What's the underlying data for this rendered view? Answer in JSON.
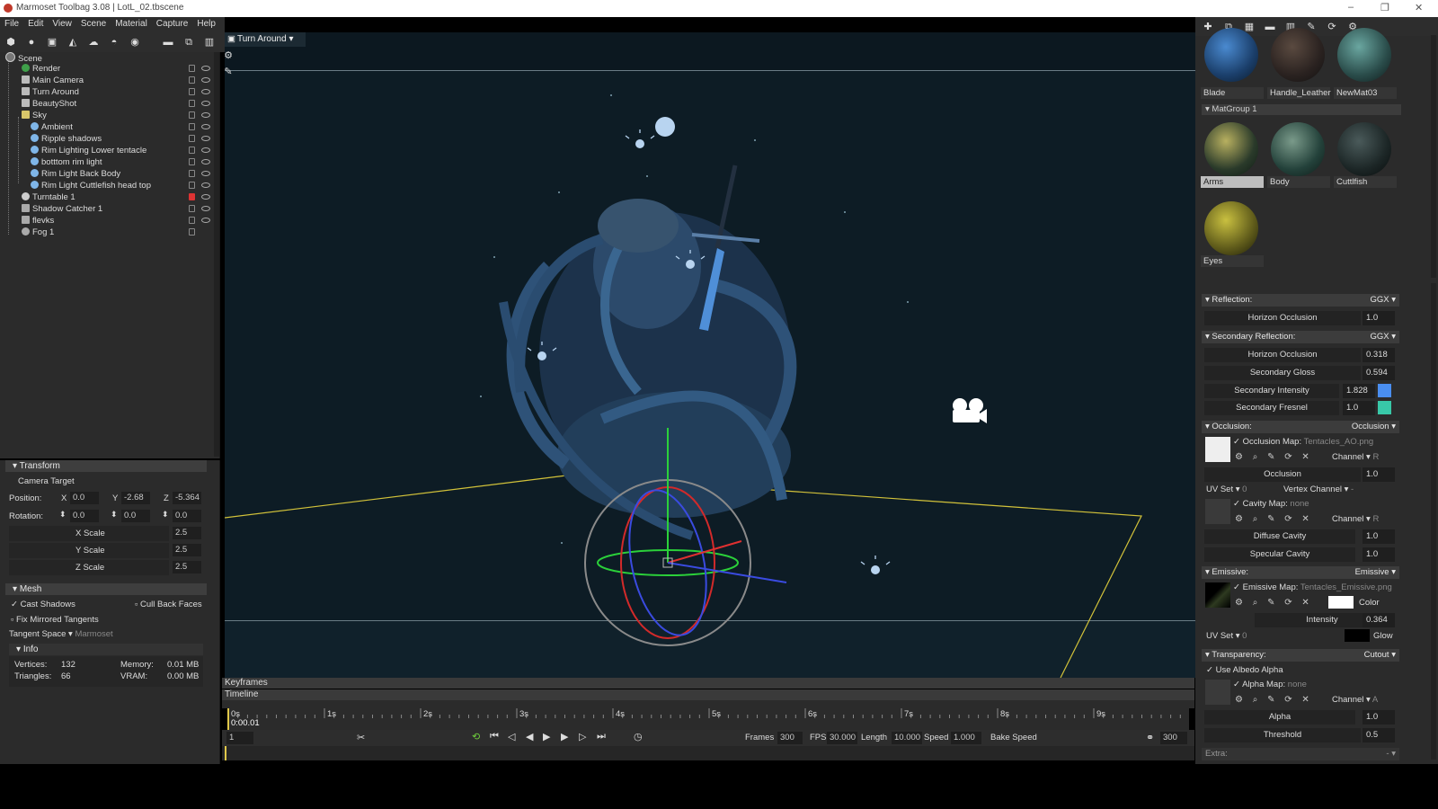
{
  "window": {
    "title": "Marmoset Toolbag 3.08  |  LotL_02.tbscene",
    "minimize": "–",
    "restore": "❐",
    "close": "✕"
  },
  "menu": [
    "File",
    "Edit",
    "View",
    "Scene",
    "Material",
    "Capture",
    "Help"
  ],
  "viewport": {
    "camera_label": "Turn Around ▾"
  },
  "outliner": {
    "items": [
      {
        "label": "Scene",
        "icon": "scene-icon",
        "depth": 0
      },
      {
        "label": "Render",
        "icon": "render-icon",
        "depth": 1
      },
      {
        "label": "Main Camera",
        "icon": "camera-icon",
        "depth": 1
      },
      {
        "label": "Turn Around",
        "icon": "camera-icon",
        "depth": 1
      },
      {
        "label": "BeautyShot",
        "icon": "camera-icon",
        "depth": 1
      },
      {
        "label": "Sky",
        "icon": "sky-icon",
        "depth": 1
      },
      {
        "label": "Ambient",
        "icon": "light-icon",
        "depth": 2
      },
      {
        "label": "Ripple shadows",
        "icon": "light-icon",
        "depth": 2
      },
      {
        "label": "Rim Lighting Lower tentacle",
        "icon": "light-icon",
        "depth": 2
      },
      {
        "label": "botttom rim light",
        "icon": "light-icon",
        "depth": 2
      },
      {
        "label": "Rim Light Back Body",
        "icon": "light-icon",
        "depth": 2
      },
      {
        "label": "Rim Light Cuttlefish head top",
        "icon": "light-icon",
        "depth": 2
      },
      {
        "label": "Turntable 1",
        "icon": "turntable-icon",
        "depth": 1
      },
      {
        "label": "Shadow Catcher 1",
        "icon": "shadow-icon",
        "depth": 1
      },
      {
        "label": "flevks",
        "icon": "mesh-icon",
        "depth": 1
      },
      {
        "label": "Fog 1",
        "icon": "fog-icon",
        "depth": 1
      }
    ]
  },
  "transform": {
    "header": "Transform",
    "camera_target": "Camera Target",
    "position_label": "Position:",
    "rotation_label": "Rotation:",
    "x": "X",
    "y": "Y",
    "z": "Z",
    "pos_x": "0.0",
    "pos_y": "-2.68",
    "pos_z": "-5.364",
    "rot_x": "0.0",
    "rot_y": "0.0",
    "rot_z": "0.0",
    "xscale_label": "X Scale",
    "yscale_label": "Y Scale",
    "zscale_label": "Z Scale",
    "xscale": "2.5",
    "yscale": "2.5",
    "zscale": "2.5"
  },
  "mesh": {
    "header": "Mesh",
    "cast_shadows": "Cast Shadows",
    "cull_back_faces": "Cull Back Faces",
    "fix_mirrored": "Fix Mirrored Tangents",
    "tangent_space_label": "Tangent Space ▾",
    "tangent_space_value": "Marmoset",
    "info_header": "Info",
    "vertices_label": "Vertices:",
    "vertices": "132",
    "triangles_label": "Triangles:",
    "triangles": "66",
    "memory_label": "Memory:",
    "memory": "0.01 MB",
    "vram_label": "VRAM:",
    "vram": "0.00 MB"
  },
  "timeline": {
    "keyframes": "Keyframes",
    "timeline": "Timeline",
    "current_time": "0:00.01",
    "ticks": [
      "0s",
      "1s",
      "2s",
      "3s",
      "4s",
      "5s",
      "6s",
      "7s",
      "8s",
      "9s"
    ],
    "frame_field": "1",
    "frames_label": "Frames",
    "frames": "300",
    "fps_label": "FPS",
    "fps": "30.000",
    "length_label": "Length",
    "length": "10.000",
    "speed_label": "Speed",
    "speed": "1.000",
    "bake_speed": "Bake Speed",
    "end_frame": "300"
  },
  "materials": {
    "top_row": [
      "Blade",
      "Handle_Leather",
      "NewMat03"
    ],
    "group": "MatGroup 1",
    "group_items": [
      "Arms",
      "Body",
      "Cuttlfish",
      "Eyes"
    ]
  },
  "reflection": {
    "header": "Reflection:",
    "mode": "GGX",
    "horizon_label": "Horizon Occlusion",
    "horizon": "1.0"
  },
  "secondary": {
    "header": "Secondary Reflection:",
    "mode": "GGX",
    "horizon_label": "Horizon Occlusion",
    "horizon": "0.318",
    "gloss_label": "Secondary Gloss",
    "gloss": "0.594",
    "intensity_label": "Secondary Intensity",
    "intensity": "1.828",
    "fresnel_label": "Secondary Fresnel",
    "fresnel": "1.0"
  },
  "occlusion": {
    "header": "Occlusion:",
    "mode": "Occlusion",
    "map_label": "Occlusion Map:",
    "map_file": "Tentacles_AO.png",
    "channel_label": "Channel ▾",
    "channel": "R",
    "occlusion_label": "Occlusion",
    "occlusion": "1.0",
    "uvset_label": "UV Set ▾",
    "uvset": "0",
    "vertex_channel": "Vertex Channel ▾",
    "vertex_channel_value": "-",
    "cavity_label": "Cavity Map:",
    "cavity_file": "none",
    "cavity_channel": "R",
    "diffuse_cavity_label": "Diffuse Cavity",
    "diffuse_cavity": "1.0",
    "specular_cavity_label": "Specular Cavity",
    "specular_cavity": "1.0"
  },
  "emissive": {
    "header": "Emissive:",
    "mode": "Emissive",
    "map_label": "Emissive Map:",
    "map_file": "Tentacles_Emissive.png",
    "color_label": "Color",
    "intensity_label": "Intensity",
    "intensity": "0.364",
    "uvset_label": "UV Set ▾",
    "uvset": "0",
    "glow_label": "Glow"
  },
  "transparency": {
    "header": "Transparency:",
    "mode": "Cutout",
    "use_albedo": "Use Albedo Alpha",
    "alpha_map_label": "Alpha Map:",
    "alpha_map_file": "none",
    "channel_label": "Channel ▾",
    "channel": "A",
    "alpha_label": "Alpha",
    "alpha": "1.0",
    "threshold_label": "Threshold",
    "threshold": "0.5",
    "extra": "Extra:"
  },
  "colors": {
    "accent_blue": "#4a8ef0",
    "accent_teal": "#38c8a8",
    "grid_yellow": "#d2c23a",
    "viewport_bg": "#0d1c25"
  }
}
